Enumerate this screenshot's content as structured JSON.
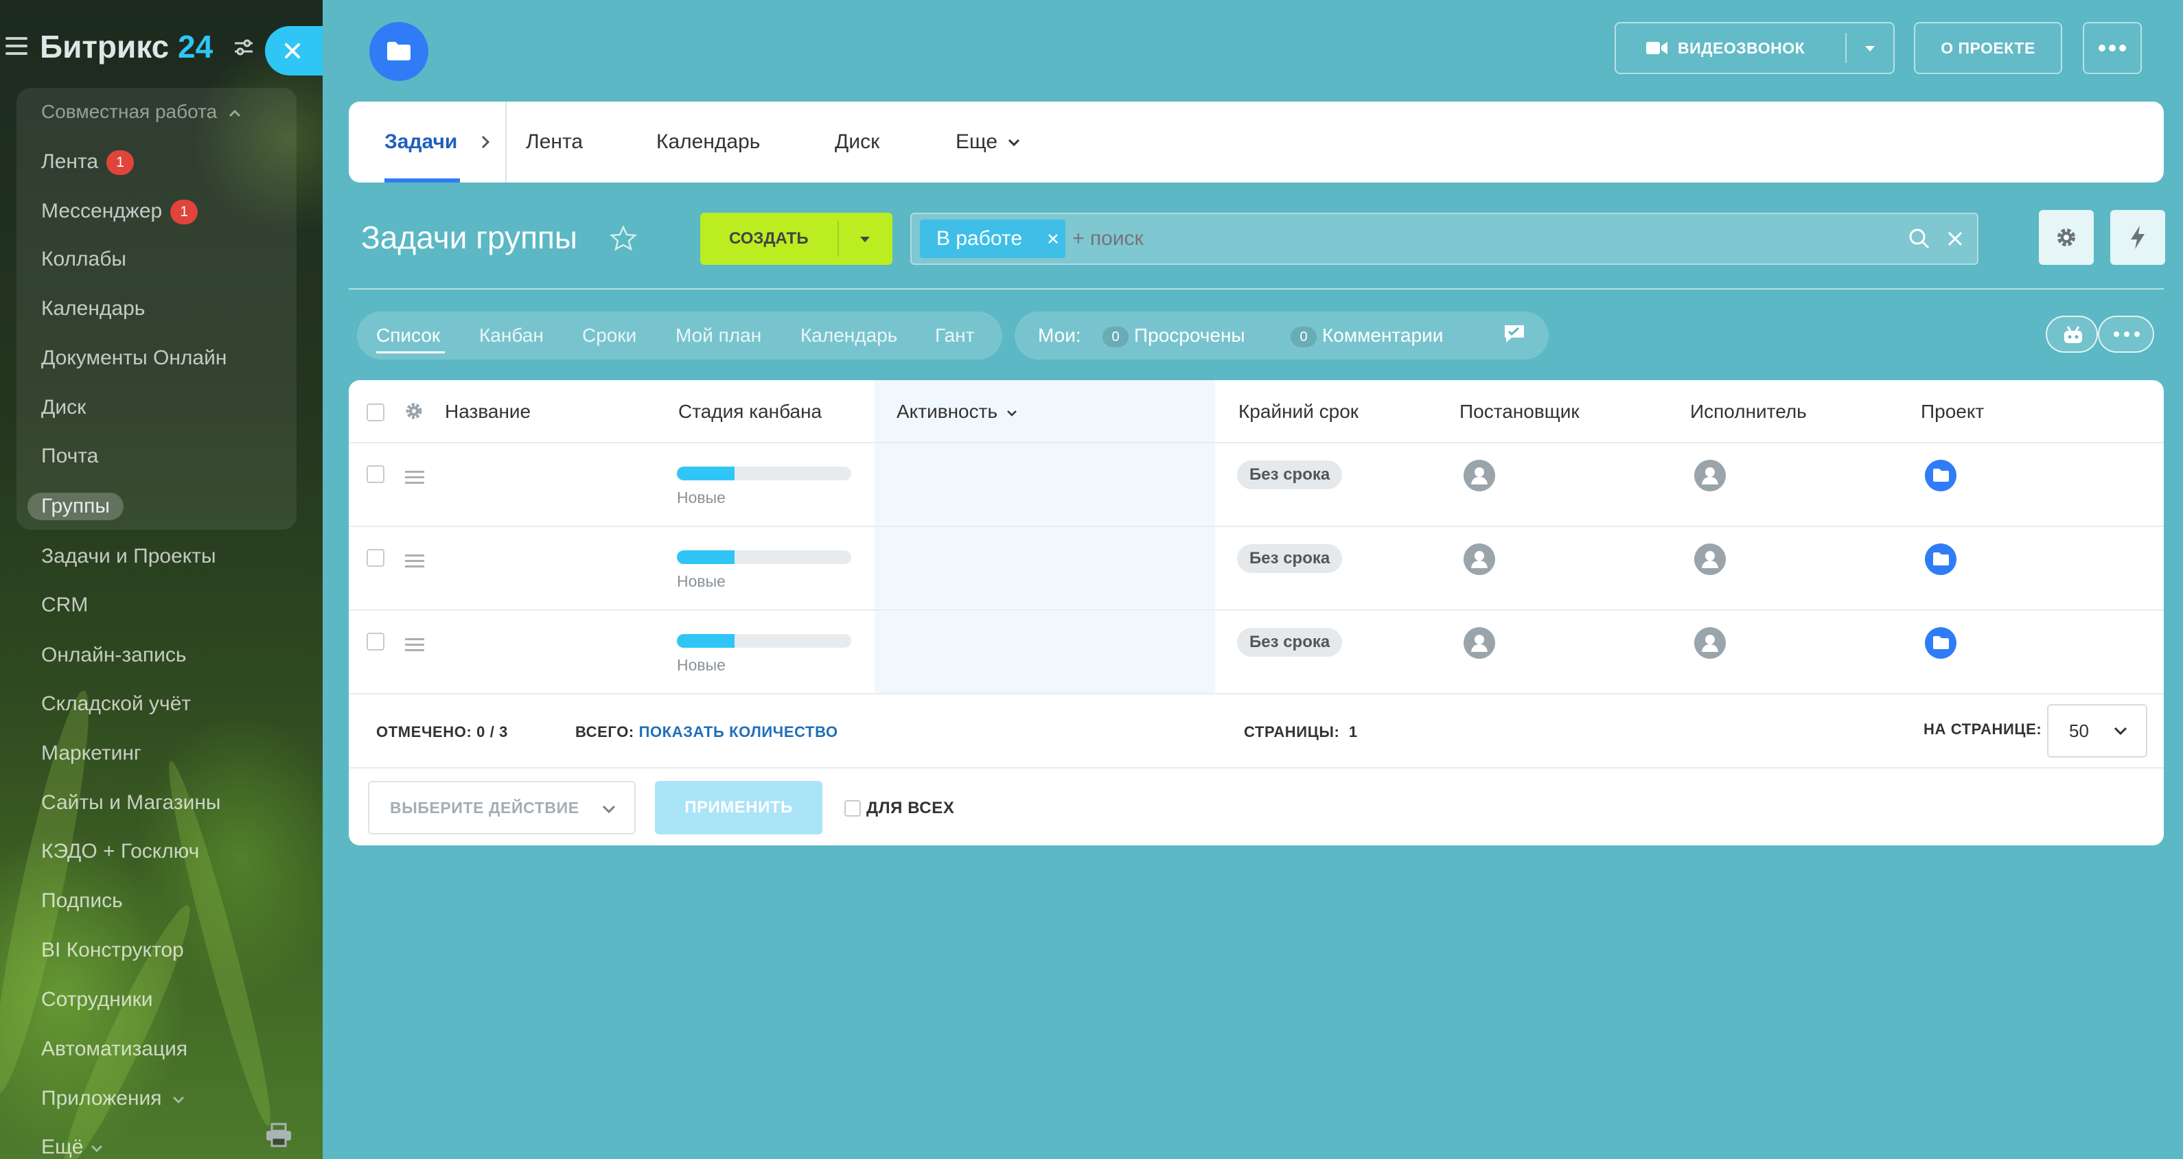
{
  "sidebar": {
    "logo": "Битрикс",
    "logo_num": "24",
    "group_title": "Совместная работа",
    "items": [
      {
        "label": "Лента",
        "count": "1"
      },
      {
        "label": "Мессенджер",
        "count": "1"
      },
      {
        "label": "Коллабы"
      },
      {
        "label": "Календарь"
      },
      {
        "label": "Документы Онлайн"
      },
      {
        "label": "Диск"
      },
      {
        "label": "Почта"
      },
      {
        "label": "Группы",
        "active": true
      },
      {
        "label": "Задачи и Проекты"
      },
      {
        "label": "CRM"
      },
      {
        "label": "Онлайн-запись"
      },
      {
        "label": "Складской учёт"
      },
      {
        "label": "Маркетинг"
      },
      {
        "label": "Сайты и Магазины"
      },
      {
        "label": "КЭДО + Госключ"
      },
      {
        "label": "Подпись"
      },
      {
        "label": "BI Конструктор"
      },
      {
        "label": "Сотрудники"
      },
      {
        "label": "Автоматизация"
      },
      {
        "label": "Приложения"
      },
      {
        "label": "Ещё"
      }
    ]
  },
  "header": {
    "project_name": "",
    "videocall_label": "ВИДЕОЗВОНОК",
    "about_label": "О ПРОЕКТЕ"
  },
  "tabs": [
    "Задачи",
    "Лента",
    "Календарь",
    "Диск",
    "Еще"
  ],
  "panel": {
    "title": "Задачи группы",
    "create_label": "СОЗДАТЬ",
    "filter_chip": "В работе",
    "search_placeholder": "+ поиск"
  },
  "views": [
    "Список",
    "Канбан",
    "Сроки",
    "Мой план",
    "Календарь",
    "Гант"
  ],
  "counters": {
    "label": "Мои:",
    "overdue_count": "0",
    "overdue_label": "Просрочены",
    "comments_count": "0",
    "comments_label": "Комментарии"
  },
  "table": {
    "columns": [
      "Название",
      "Стадия канбана",
      "Активность",
      "Крайний срок",
      "Постановщик",
      "Исполнитель",
      "Проект"
    ],
    "rows": [
      {
        "name": "",
        "stage": "Новые",
        "stage_progress": 0.33,
        "activity": "",
        "deadline": "Без срока",
        "creator": "",
        "assignee": "",
        "project": ""
      },
      {
        "name": "",
        "stage": "Новые",
        "stage_progress": 0.33,
        "activity": "",
        "deadline": "Без срока",
        "creator": "",
        "assignee": "",
        "project": ""
      },
      {
        "name": "",
        "stage": "Новые",
        "stage_progress": 0.33,
        "activity": "",
        "deadline": "Без срока",
        "creator": "",
        "assignee": "",
        "project": ""
      }
    ]
  },
  "footer": {
    "selected_label": "ОТМЕЧЕНО:",
    "selected_value": "0 / 3",
    "total_label": "ВСЕГО:",
    "total_link": "ПОКАЗАТЬ КОЛИЧЕСТВО",
    "pages_label": "СТРАНИЦЫ:",
    "pages_value": "1",
    "per_page_label": "НА СТРАНИЦЕ:",
    "per_page_value": "50",
    "action_placeholder": "ВЫБЕРИТЕ ДЕЙСТВИЕ",
    "apply_label": "ПРИМЕНИТЬ",
    "for_all_label": "ДЛЯ ВСЕХ"
  },
  "colors": {
    "accent": "#2fc6f6",
    "create": "#bbed21",
    "stage": "#2fc6f6",
    "background": "#5bb8c4",
    "badge": "#e0443a"
  }
}
